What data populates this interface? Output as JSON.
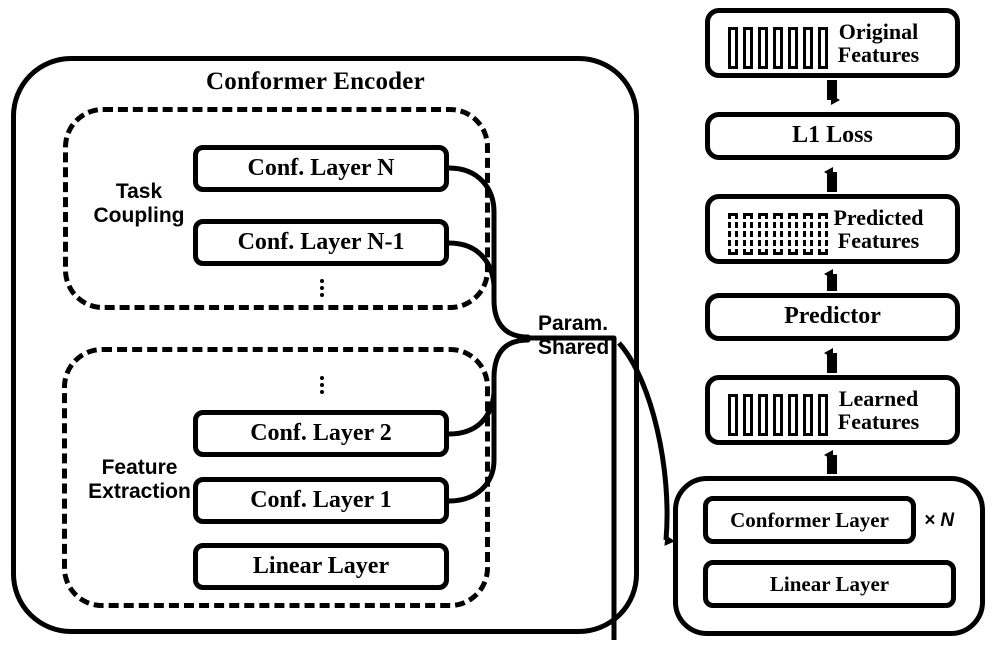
{
  "diagram": {
    "title": "Conformer Encoder",
    "left_panel": {
      "title": "Conformer Encoder",
      "groups": [
        {
          "label": "Task\nCoupling",
          "layers": [
            "Conf. Layer N",
            "Conf. Layer N-1"
          ],
          "ellipsis": "⋮"
        },
        {
          "label": "Feature\nExtraction",
          "layers": [
            "Conf. Layer 2",
            "Conf. Layer 1",
            "Linear Layer"
          ],
          "ellipsis": "⋮"
        }
      ]
    },
    "connector": {
      "label": "Param.\nShared"
    },
    "right_panel": {
      "blocks": [
        {
          "name": "original-features",
          "text": "Original\nFeatures",
          "glyph": "solid-bars",
          "bar_count": 7
        },
        {
          "name": "l1-loss",
          "text": "L1 Loss",
          "glyph": "none",
          "bar_count": 0
        },
        {
          "name": "predicted-features",
          "text": "Predicted\nFeatures",
          "glyph": "dashed-bars",
          "bar_count": 7
        },
        {
          "name": "predictor",
          "text": "Predictor",
          "glyph": "none",
          "bar_count": 0
        },
        {
          "name": "learned-features",
          "text": "Learned\nFeatures",
          "glyph": "solid-bars",
          "bar_count": 7
        }
      ],
      "bottom_module": {
        "layers": [
          "Conformer Layer",
          "Linear Layer"
        ],
        "multiplier": "× N"
      }
    },
    "colors": {
      "stroke": "#000000",
      "background": "#ffffff"
    }
  }
}
